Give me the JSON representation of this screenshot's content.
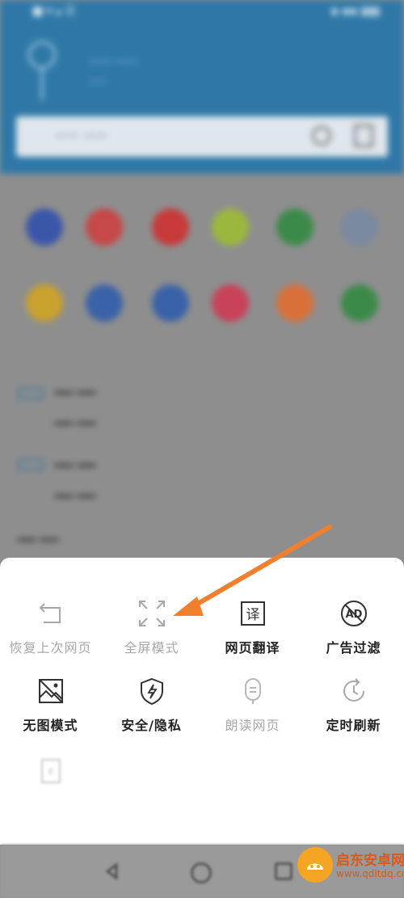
{
  "background": {
    "status_left": "■ ▾ ▴ ☰",
    "status_right": "▪ ▪▪ ▮▮▮",
    "weather_title": "—— ——",
    "weather_sub": "——",
    "search_placeholder": "—— ——",
    "news": [
      {
        "line1": "——",
        "line2": "——"
      },
      {
        "line1": "——",
        "line2": "——"
      },
      {
        "line1": "——"
      }
    ]
  },
  "menu": {
    "items": [
      {
        "label": "恢复上次网页",
        "icon": "restore-arrow-icon",
        "enabled": false
      },
      {
        "label": "全屏模式",
        "icon": "fullscreen-icon",
        "enabled": false
      },
      {
        "label": "网页翻译",
        "icon": "translate-icon",
        "enabled": true
      },
      {
        "label": "广告过滤",
        "icon": "ad-block-icon",
        "enabled": true
      },
      {
        "label": "无图模式",
        "icon": "no-image-icon",
        "enabled": true
      },
      {
        "label": "安全/隐私",
        "icon": "shield-icon",
        "enabled": true
      },
      {
        "label": "朗读网页",
        "icon": "read-aloud-icon",
        "enabled": false
      },
      {
        "label": "定时刷新",
        "icon": "timer-refresh-icon",
        "enabled": true
      },
      {
        "label": "",
        "icon": "save-page-icon",
        "enabled": false
      }
    ]
  },
  "annotation": {
    "color": "#f07f2e"
  },
  "watermark": {
    "name": "启东安卓网",
    "url": "www.qdltdq.com"
  },
  "colors": {
    "header_blue": "#2e78a8",
    "sheet_bg": "#ffffff",
    "disabled_text": "#a8a8a8",
    "enabled_text": "#222222"
  }
}
